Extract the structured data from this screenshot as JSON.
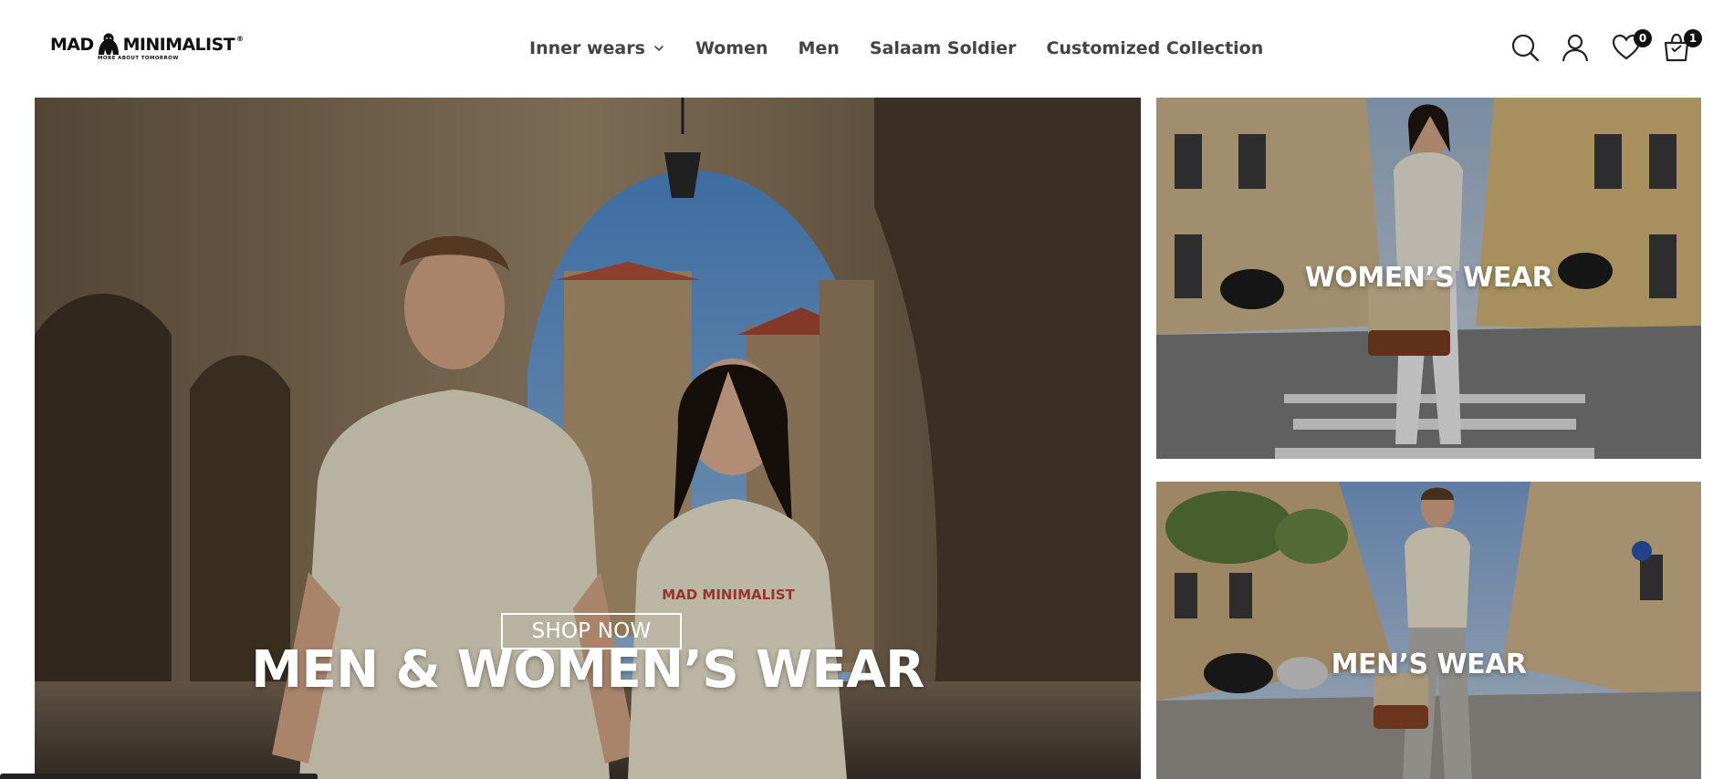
{
  "brand": {
    "logo_text_left": "MAD",
    "logo_text_right": "MINIMALIST",
    "logo_registered": "®",
    "tagline": "MORE ABOUT TOMORROW"
  },
  "nav": {
    "items": [
      {
        "label": "Inner wears",
        "has_dropdown": true
      },
      {
        "label": "Women"
      },
      {
        "label": "Men"
      },
      {
        "label": "Salaam Soldier"
      },
      {
        "label": "Customized Collection"
      }
    ]
  },
  "header_icons": {
    "search": "search-icon",
    "account": "user-icon",
    "wishlist": {
      "icon": "heart-icon",
      "count": "0"
    },
    "cart": {
      "icon": "shopping-bag-icon",
      "count": "1"
    }
  },
  "hero": {
    "main": {
      "title": "MEN & WOMEN’S WEAR",
      "button": "SHOP NOW",
      "shirt_print": "MAD MINIMALIST"
    },
    "women": {
      "title": "WOMEN’S WEAR"
    },
    "men": {
      "title": "MEN’S WEAR"
    }
  },
  "colors": {
    "text_nav": "#444444",
    "badge_bg": "#111111",
    "overlay": "rgba(0,0,0,0.22)"
  }
}
